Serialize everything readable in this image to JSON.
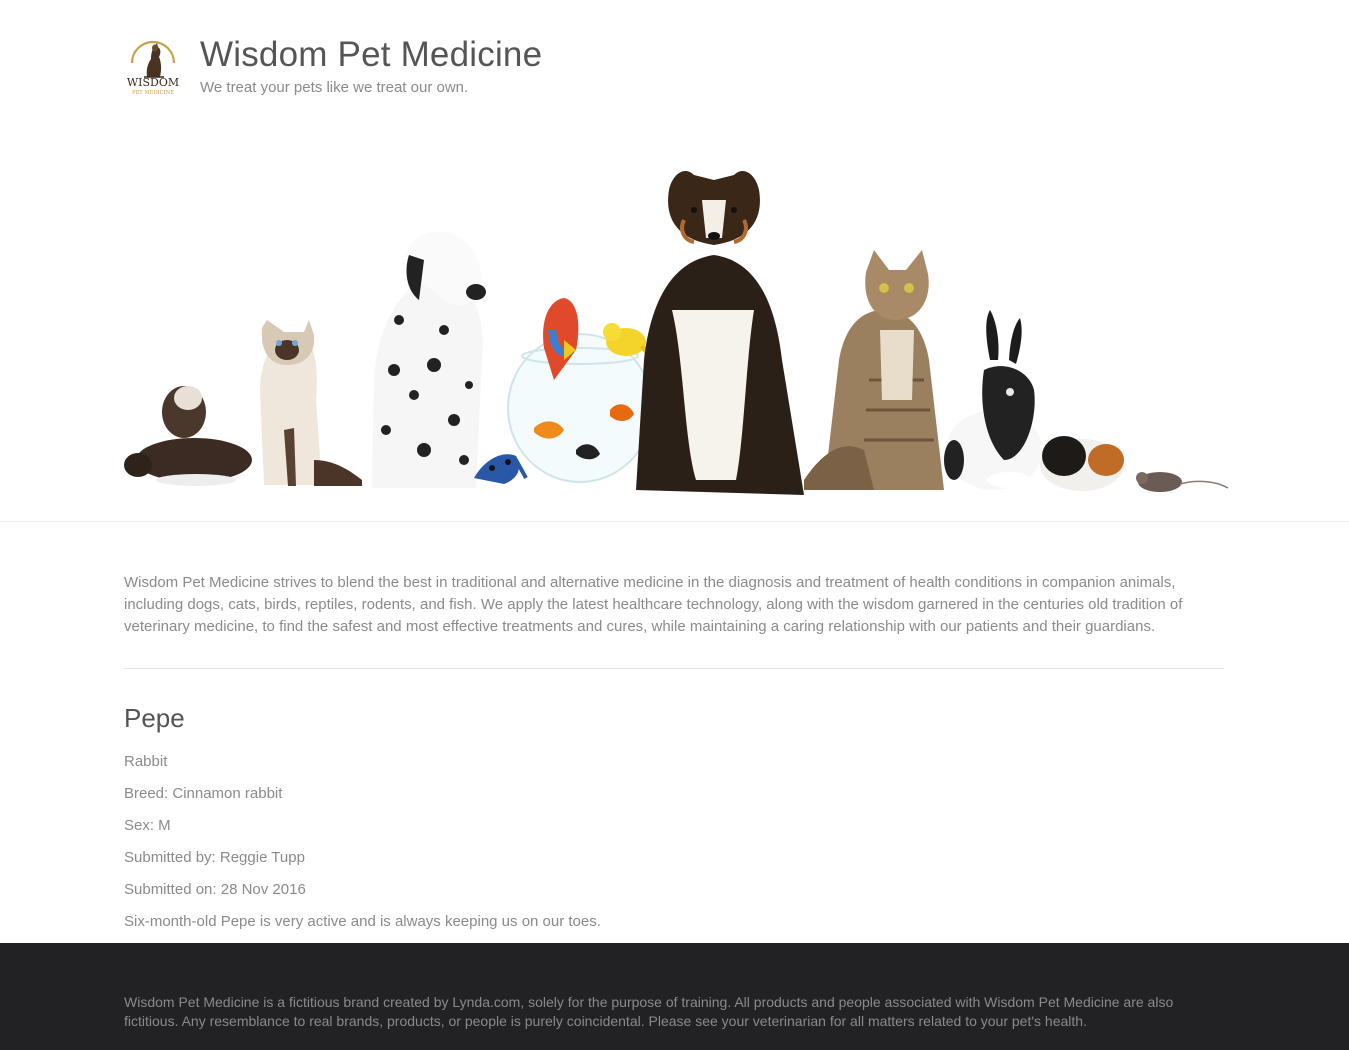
{
  "header": {
    "logo_text": "WISDOM",
    "logo_subtext": "PET MEDICINE",
    "title": "Wisdom Pet Medicine",
    "tagline": "We treat your pets like we treat our own."
  },
  "intro": {
    "text": "Wisdom Pet Medicine strives to blend the best in traditional and alternative medicine in the diagnosis and treatment of health conditions in companion animals, including dogs, cats, birds, reptiles, rodents, and fish. We apply the latest healthcare technology, along with the wisdom garnered in the centuries old tradition of veterinary medicine, to find the safest and most effective treatments and cures, while maintaining a caring relationship with our patients and their guardians."
  },
  "pet": {
    "name": "Pepe",
    "species": "Rabbit",
    "breed": "Breed: Cinnamon rabbit",
    "sex": "Sex: M",
    "submitted_by": "Submitted by: Reggie Tupp",
    "submitted_on": "Submitted on: 28 Nov 2016",
    "description": "Six-month-old Pepe is very active and is always keeping us on our toes."
  },
  "footer": {
    "text": "Wisdom Pet Medicine is a fictitious brand created by Lynda.com, solely for the purpose of training. All products and people associated with Wisdom Pet Medicine are also fictitious. Any resemblance to real brands, products, or people is purely coincidental. Please see your veterinarian for all matters related to your pet's health."
  },
  "colors": {
    "gold": "#c9a14a",
    "footer_bg": "#222224",
    "title": "#555555",
    "text": "#8a8a8a"
  }
}
